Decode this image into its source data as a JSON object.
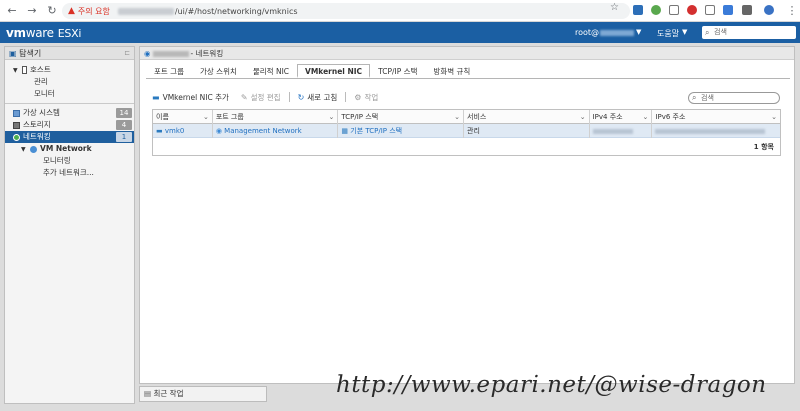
{
  "browser": {
    "warning_label": "주의 요함",
    "url_path": "/ui/#/host/networking/vmknics"
  },
  "header": {
    "logo_bold": "vm",
    "logo_ware": "ware",
    "product": "ESXi",
    "user": "root@",
    "help": "도움말",
    "search_placeholder": "검색"
  },
  "navigator": {
    "title": "탐색기",
    "items": [
      {
        "label": "호스트"
      },
      {
        "label": "관리"
      },
      {
        "label": "모니터"
      },
      {
        "label": "가상 시스템",
        "count": "14"
      },
      {
        "label": "스토리지",
        "count": "4"
      },
      {
        "label": "네트워킹",
        "count": "1"
      },
      {
        "label": "VM Network"
      },
      {
        "label": "모니터링"
      },
      {
        "label": "추가 네트워크..."
      }
    ]
  },
  "main": {
    "breadcrumb_suffix": "- 네트워킹",
    "tabs": [
      "포트 그룹",
      "가상 스위치",
      "물리적 NIC",
      "VMkernel NIC",
      "TCP/IP 스택",
      "방화벽 규칙"
    ],
    "toolbar": {
      "add": "VMkernel NIC 추가",
      "edit": "설정 편집",
      "refresh": "새로 고침",
      "actions": "작업"
    },
    "filter_placeholder": "검색",
    "table": {
      "headers": [
        "이름",
        "포트 그룹",
        "TCP/IP 스택",
        "서비스",
        "IPv4 주소",
        "IPv6 주소"
      ],
      "rows": [
        {
          "name": "vmk0",
          "portgroup": "Management Network",
          "stack": "기본 TCP/IP 스택",
          "service": "관리"
        }
      ],
      "footer": "1 항목"
    }
  },
  "recent_tasks": "최근 작업",
  "watermark": "http://www.epari.net/@wise-dragon"
}
